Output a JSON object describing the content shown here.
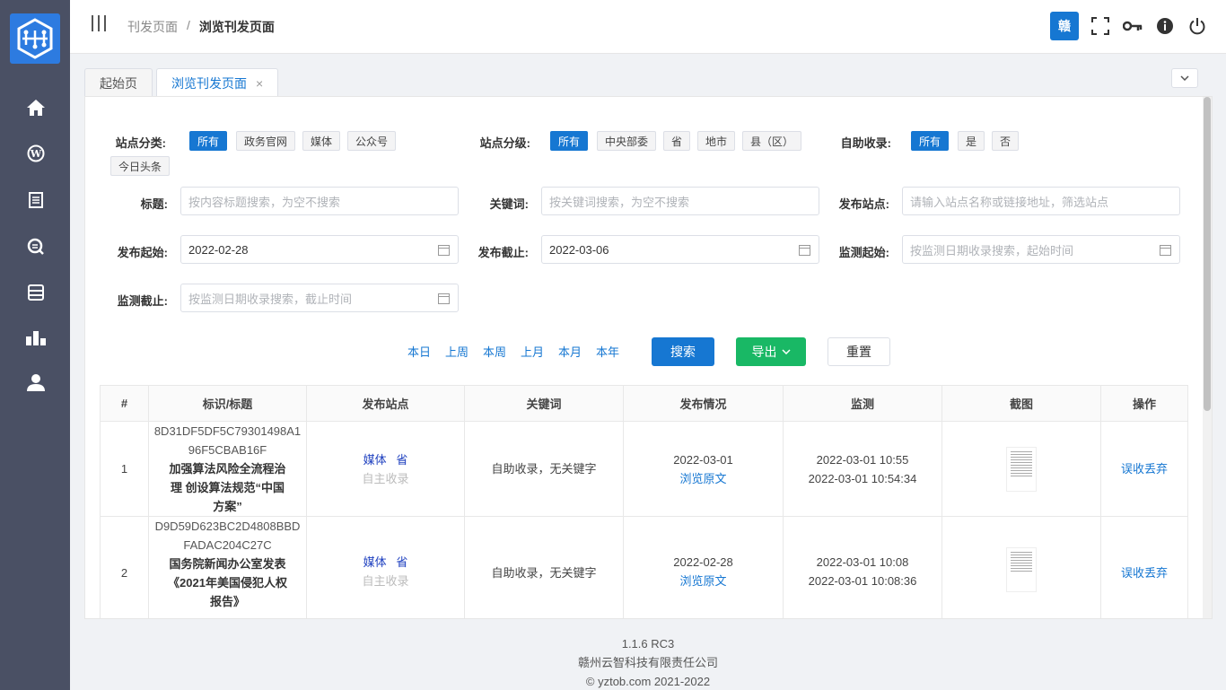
{
  "header": {
    "breadcrumb": [
      "刊发页面",
      "浏览刊发页面"
    ],
    "separator": "/",
    "badge": "赣"
  },
  "sidebar": {
    "icons": [
      "home-icon",
      "wordpress-icon",
      "document-icon",
      "search-icon",
      "storage-icon",
      "chart-icon",
      "user-icon"
    ]
  },
  "tabs": [
    {
      "label": "起始页"
    },
    {
      "label": "浏览刊发页面",
      "close": "×"
    }
  ],
  "filters": {
    "site_type": {
      "label": "站点分类:",
      "options": [
        "所有",
        "政务官网",
        "媒体",
        "公众号",
        "今日头条"
      ]
    },
    "site_level": {
      "label": "站点分级:",
      "options": [
        "所有",
        "中央部委",
        "省",
        "地市",
        "县（区）"
      ]
    },
    "self_collect": {
      "label": "自助收录:",
      "options": [
        "所有",
        "是",
        "否"
      ]
    },
    "title": {
      "label": "标题:",
      "placeholder": "按内容标题搜索，为空不搜索"
    },
    "keyword": {
      "label": "关键词:",
      "placeholder": "按关键词搜索，为空不搜索"
    },
    "site": {
      "label": "发布站点:",
      "placeholder": "请输入站点名称或链接地址，筛选站点"
    },
    "pub_start": {
      "label": "发布起始:",
      "value": "2022-02-28"
    },
    "pub_end": {
      "label": "发布截止:",
      "value": "2022-03-06"
    },
    "mon_start": {
      "label": "监测起始:",
      "placeholder": "按监测日期收录搜索，起始时间"
    },
    "mon_end": {
      "label": "监测截止:",
      "placeholder": "按监测日期收录搜索，截止时间"
    }
  },
  "quick_ranges": [
    "本日",
    "上周",
    "本周",
    "上月",
    "本月",
    "本年"
  ],
  "buttons": {
    "search": "搜索",
    "export": "导出",
    "reset": "重置"
  },
  "table": {
    "headers": [
      "#",
      "标识/标题",
      "发布站点",
      "关键词",
      "发布情况",
      "监测",
      "截图",
      "操作"
    ],
    "rows": [
      {
        "num": "1",
        "id": "8D31DF5DF5C79301498A196F5CBAB16F",
        "title": "加强算法风险全流程治理 创设算法规范“中国方案”",
        "site_type": "媒体",
        "site_level": "省",
        "collect": "自主收录",
        "keyword": "自助收录，无关键字",
        "pub_date": "2022-03-01",
        "view": "浏览原文",
        "mon1": "2022-03-01 10:55",
        "mon2": "2022-03-01 10:54:34",
        "action": "误收丢弃"
      },
      {
        "num": "2",
        "id": "D9D59D623BC2D4808BBDFADAC204C27C",
        "title": "国务院新闻办公室发表《2021年美国侵犯人权报告》",
        "site_type": "媒体",
        "site_level": "省",
        "collect": "自主收录",
        "keyword": "自助收录，无关键字",
        "pub_date": "2022-02-28",
        "view": "浏览原文",
        "mon1": "2022-03-01 10:08",
        "mon2": "2022-03-01 10:08:36",
        "action": "误收丢弃"
      }
    ]
  },
  "footer": {
    "version": "1.1.6 RC3",
    "company": "赣州云智科技有限责任公司",
    "copyright": "© yztob.com 2021-2022"
  }
}
